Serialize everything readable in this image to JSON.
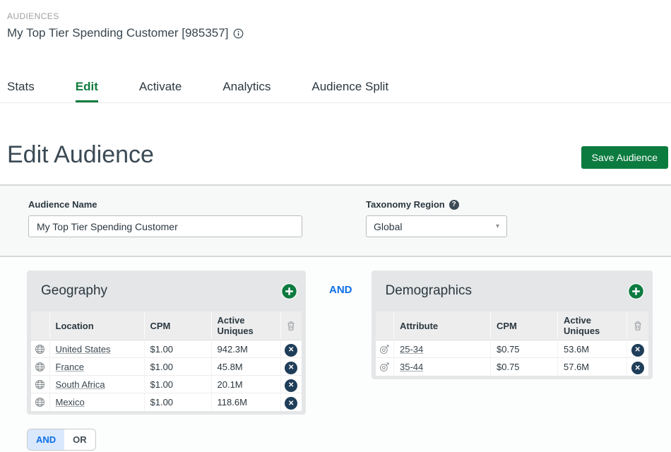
{
  "header": {
    "breadcrumb": "AUDIENCES",
    "title": "My Top Tier Spending Customer [985357]",
    "info_icon": "info-icon"
  },
  "tabs": [
    {
      "label": "Stats",
      "active": false
    },
    {
      "label": "Edit",
      "active": true
    },
    {
      "label": "Activate",
      "active": false
    },
    {
      "label": "Analytics",
      "active": false
    },
    {
      "label": "Audience Split",
      "active": false
    }
  ],
  "page": {
    "heading": "Edit Audience",
    "save_button": "Save Audience"
  },
  "form": {
    "audience_name": {
      "label": "Audience Name",
      "value": "My Top Tier Spending Customer"
    },
    "taxonomy_region": {
      "label": "Taxonomy Region",
      "value": "Global",
      "help_icon": "help-icon",
      "caret_icon": "caret-down-icon",
      "help_glyph": "?",
      "caret_glyph": "▾"
    }
  },
  "operator_between_groups": "AND",
  "groups": [
    {
      "title": "Geography",
      "row_icon": "globe-icon",
      "columns": {
        "name": "Location",
        "cpm": "CPM",
        "uniques": "Active Uniques"
      },
      "rows": [
        {
          "name": "United States",
          "cpm": "$1.00",
          "uniques": "942.3M"
        },
        {
          "name": "France",
          "cpm": "$1.00",
          "uniques": "45.8M"
        },
        {
          "name": "South Africa",
          "cpm": "$1.00",
          "uniques": "20.1M"
        },
        {
          "name": "Mexico",
          "cpm": "$1.00",
          "uniques": "118.6M"
        }
      ]
    },
    {
      "title": "Demographics",
      "row_icon": "target-icon",
      "columns": {
        "name": "Attribute",
        "cpm": "CPM",
        "uniques": "Active Uniques"
      },
      "rows": [
        {
          "name": "25-34",
          "cpm": "$0.75",
          "uniques": "53.6M"
        },
        {
          "name": "35-44",
          "cpm": "$0.75",
          "uniques": "57.6M"
        }
      ]
    }
  ],
  "toggle": {
    "options": [
      "AND",
      "OR"
    ],
    "selected": "AND"
  },
  "colors": {
    "accent_green": "#0c7b3f",
    "tab_active_green": "#0f7b3d",
    "operator_blue": "#0d6fe8",
    "remove_navy": "#1e3d59",
    "panel_gray": "#e4e6e7",
    "form_strip_gray": "#f7f8f8",
    "heading_slate": "#3b4a54"
  }
}
